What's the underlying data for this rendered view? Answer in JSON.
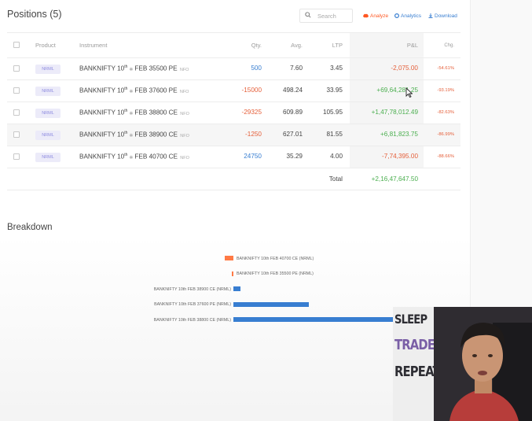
{
  "header": {
    "title": "Positions",
    "count": "(5)",
    "search_placeholder": "Search",
    "actions": {
      "analyze": "Analyze",
      "analytics": "Analytics",
      "download": "Download"
    }
  },
  "table": {
    "columns": {
      "product": "Product",
      "instrument": "Instrument",
      "qty": "Qty.",
      "avg": "Avg.",
      "ltp": "LTP",
      "pnl": "P&L",
      "chg": "Chg."
    },
    "rows": [
      {
        "product": "NRML",
        "name": "BANKNIFTY 10",
        "sup": "th",
        "contract": "FEB 35500 PE",
        "exchange": "NFO",
        "qty": "500",
        "avg": "7.60",
        "ltp": "3.45",
        "pnl": "-2,075.00",
        "chg": "-54.61%"
      },
      {
        "product": "NRML",
        "name": "BANKNIFTY 10",
        "sup": "th",
        "contract": "FEB 37600 PE",
        "exchange": "NFO",
        "qty": "-15000",
        "avg": "498.24",
        "ltp": "33.95",
        "pnl": "+69,64,281.25",
        "chg": "-93.19%"
      },
      {
        "product": "NRML",
        "name": "BANKNIFTY 10",
        "sup": "th",
        "contract": "FEB 38800 CE",
        "exchange": "NFO",
        "qty": "-29325",
        "avg": "609.89",
        "ltp": "105.95",
        "pnl": "+1,47,78,012.49",
        "chg": "-82.63%"
      },
      {
        "product": "NRML",
        "name": "BANKNIFTY 10",
        "sup": "th",
        "contract": "FEB 38900 CE",
        "exchange": "NFO",
        "qty": "-1250",
        "avg": "627.01",
        "ltp": "81.55",
        "pnl": "+6,81,823.75",
        "chg": "-86.99%"
      },
      {
        "product": "NRML",
        "name": "BANKNIFTY 10",
        "sup": "th",
        "contract": "FEB 40700 CE",
        "exchange": "NFO",
        "qty": "24750",
        "avg": "35.29",
        "ltp": "4.00",
        "pnl": "-7,74,395.00",
        "chg": "-88.66%"
      }
    ],
    "total_label": "Total",
    "total_value": "+2,16,47,647.50"
  },
  "breakdown": {
    "title": "Breakdown",
    "items": [
      {
        "label": "BANKNIFTY 10th FEB 40700 CE (NRML)",
        "value": -774395.0
      },
      {
        "label": "BANKNIFTY 10th FEB 35500 PE (NRML)",
        "value": -2075.0
      },
      {
        "label": "BANKNIFTY 10th FEB 38900 CE (NRML)",
        "value": 681823.75
      },
      {
        "label": "BANKNIFTY 10th FEB 37600 PE (NRML)",
        "value": 6964281.25
      },
      {
        "label": "BANKNIFTY 10th FEB 38800 CE (NRML)",
        "value": 14778012.49
      }
    ],
    "colors": {
      "positive": "#387ed1",
      "negative": "#ff7a45"
    }
  },
  "overlay": {
    "poster_lines": [
      "SLEEP",
      "TRADE",
      "REPEAT"
    ]
  },
  "colors": {
    "profit": "#4caf50",
    "loss": "#e5603b",
    "accent": "#387ed1",
    "badge_bg": "#ecebf9",
    "badge_text": "#8e8be0"
  }
}
